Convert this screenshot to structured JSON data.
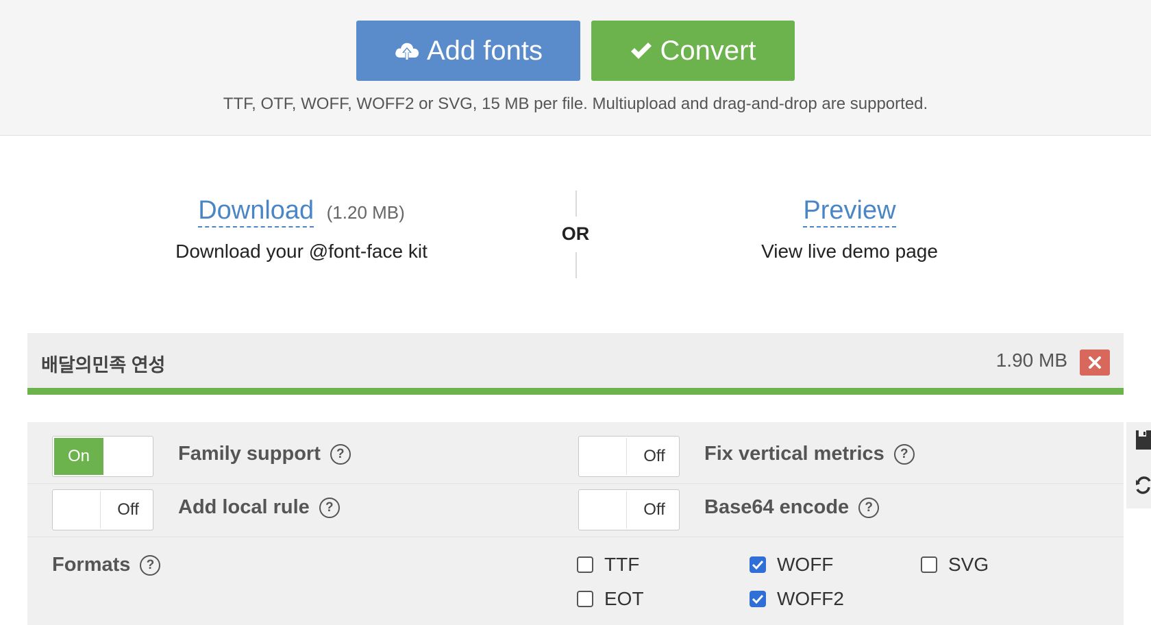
{
  "upload": {
    "add_fonts": "Add fonts",
    "convert": "Convert",
    "hint": "TTF, OTF, WOFF, WOFF2 or SVG, 15 MB per file. Multiupload and drag-and-drop are supported."
  },
  "result": {
    "download_label": "Download",
    "download_size": "(1.20 MB)",
    "download_desc": "Download your @font-face kit",
    "or": "OR",
    "preview_label": "Preview",
    "preview_desc": "View live demo page"
  },
  "file": {
    "name": "배달의민족 연성",
    "size": "1.90 MB",
    "progress": 1.0
  },
  "options": {
    "family_support": {
      "label": "Family support",
      "state": "On"
    },
    "fix_vertical_metrics": {
      "label": "Fix vertical metrics",
      "state": "Off"
    },
    "add_local_rule": {
      "label": "Add local rule",
      "state": "Off"
    },
    "base64_encode": {
      "label": "Base64 encode",
      "state": "Off"
    },
    "help_glyph": "?",
    "formats_label": "Formats",
    "formats": [
      {
        "name": "TTF",
        "checked": false
      },
      {
        "name": "WOFF",
        "checked": true
      },
      {
        "name": "SVG",
        "checked": false
      },
      {
        "name": "EOT",
        "checked": false
      },
      {
        "name": "WOFF2",
        "checked": true
      }
    ]
  },
  "colors": {
    "add_button": "#5a8ccc",
    "convert_button": "#6cb24d",
    "link": "#4a86c5",
    "remove_button": "#d9685c",
    "checkbox_checked": "#2f6fd6"
  },
  "icons": [
    "cloud-upload-icon",
    "checkmark-icon",
    "close-icon",
    "save-icon",
    "refresh-icon"
  ]
}
